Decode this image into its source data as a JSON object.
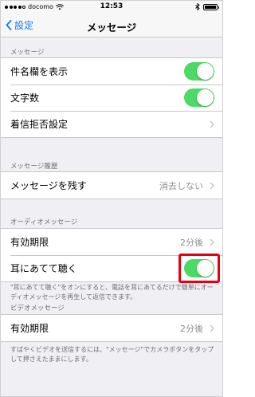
{
  "status_bar": {
    "carrier": "docomo",
    "time": "12:53",
    "battery_level": 1.0
  },
  "nav": {
    "back_label": "設定",
    "title": "メッセージ"
  },
  "sections": {
    "message": {
      "header": "メッセージ",
      "rows": [
        {
          "label": "件名欄を表示",
          "toggle_on": true
        },
        {
          "label": "文字数",
          "toggle_on": true
        },
        {
          "label": "着信拒否設定"
        }
      ]
    },
    "history": {
      "header": "メッセージ履歴",
      "rows": [
        {
          "label": "メッセージを残す",
          "value": "消去しない"
        }
      ]
    },
    "audio": {
      "header": "オーディオメッセージ",
      "rows": [
        {
          "label": "有効期限",
          "value": "2分後"
        },
        {
          "label": "耳にあてて聴く",
          "toggle_on": true
        }
      ],
      "footer": "\"耳にあてて聴く\"をオンにすると、電話を耳にあてるだけで簡単にオーディオメッセージを再生して返信できます。"
    },
    "video": {
      "header": "ビデオメッセージ",
      "rows": [
        {
          "label": "有効期限",
          "value": "2分後"
        }
      ],
      "footer": "すばやくビデオを送信するには、\"メッセージ\"でカメラボタンをタップして押さえたままにします。"
    }
  },
  "colors": {
    "accent": "#0a7aff",
    "toggle_on": "#4cd964",
    "highlight": "#e60012"
  }
}
